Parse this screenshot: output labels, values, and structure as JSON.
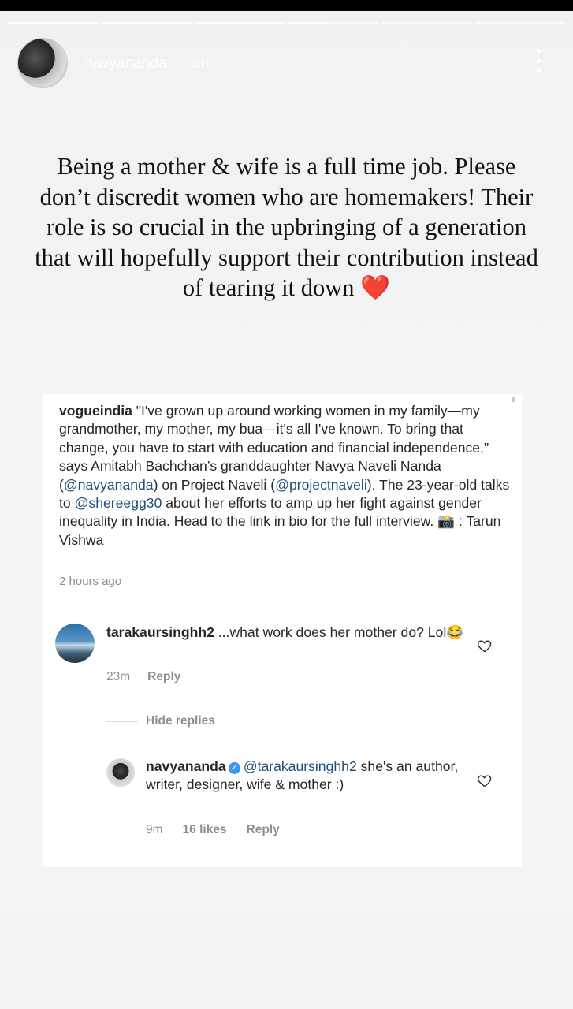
{
  "story": {
    "progress": [
      1,
      1,
      1,
      0.45,
      0,
      0
    ],
    "username": "navyananda",
    "time_ago": "9h",
    "caption": "Being a mother & wife is a full time job. Please don’t discredit women who are homemakers! Their role is so crucial in the upbringing of a generation that will hopefully support their contribution instead of tearing it down",
    "caption_emoji": "❤️"
  },
  "post": {
    "author": "vogueindia",
    "text_part1": "\"I've grown up around working women in my family—my grandmother, my mother, my bua—it's all I've known. To bring that change, you have to start with education and financial independence,\" says Amitabh Bachchan’s granddaughter Navya Naveli Nanda (",
    "mention1": "@navyananda",
    "text_part2": ") on Project Naveli (",
    "mention2": "@projectnaveli",
    "text_part3": "). The 23-year-old talks to ",
    "mention3": "@shereegg30",
    "text_part4": " about her efforts to amp up her fight against gender inequality in India. Head to the link in bio for the full interview. 📸 : Tarun Vishwa",
    "time_ago": "2 hours ago"
  },
  "comments": [
    {
      "author": "tarakaursinghh2",
      "text": " ...what work does her mother do? Lol😂",
      "time_ago": "23m",
      "reply_label": "Reply"
    }
  ],
  "hide_replies_label": "Hide replies",
  "reply": {
    "author": "navyananda",
    "mention": "@tarakaursinghh2",
    "text": " she's an author, writer, designer, wife & mother :)",
    "time_ago": "9m",
    "likes": "16 likes",
    "reply_label": "Reply"
  },
  "colors": {
    "mention": "#1f4e79",
    "verified": "#3897f0",
    "heart": "#e3162a"
  }
}
